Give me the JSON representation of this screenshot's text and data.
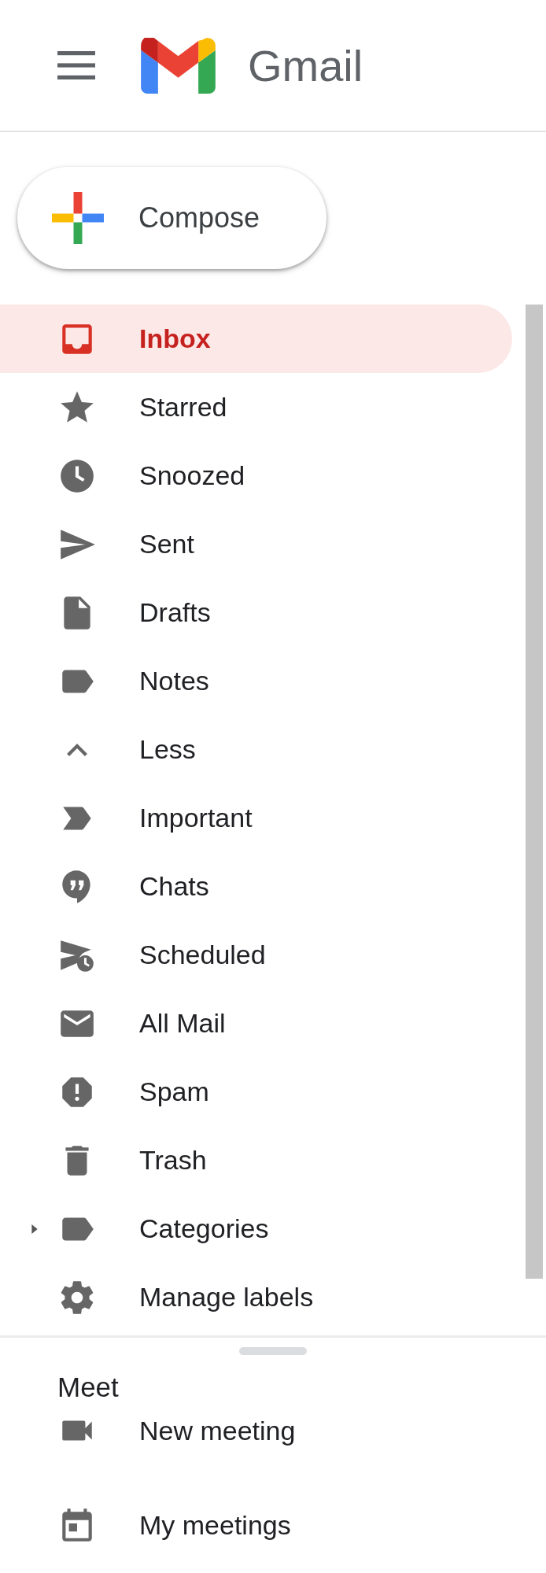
{
  "header": {
    "app_name": "Gmail"
  },
  "compose": {
    "label": "Compose"
  },
  "nav": [
    {
      "kind": "inbox",
      "label": "Inbox",
      "selected": true
    },
    {
      "kind": "star",
      "label": "Starred",
      "selected": false
    },
    {
      "kind": "clock",
      "label": "Snoozed",
      "selected": false
    },
    {
      "kind": "send",
      "label": "Sent",
      "selected": false
    },
    {
      "kind": "file",
      "label": "Drafts",
      "selected": false
    },
    {
      "kind": "label",
      "label": "Notes",
      "selected": false
    },
    {
      "kind": "less",
      "label": "Less",
      "selected": false
    },
    {
      "kind": "important",
      "label": "Important",
      "selected": false
    },
    {
      "kind": "chat",
      "label": "Chats",
      "selected": false
    },
    {
      "kind": "scheduled",
      "label": "Scheduled",
      "selected": false
    },
    {
      "kind": "mail",
      "label": "All Mail",
      "selected": false
    },
    {
      "kind": "spam",
      "label": "Spam",
      "selected": false
    },
    {
      "kind": "trash",
      "label": "Trash",
      "selected": false
    },
    {
      "kind": "category",
      "label": "Categories",
      "selected": false,
      "expanded": false
    },
    {
      "kind": "gear",
      "label": "Manage labels",
      "selected": false
    }
  ],
  "meet": {
    "title": "Meet",
    "items": [
      {
        "kind": "video",
        "label": "New meeting"
      },
      {
        "kind": "calendar",
        "label": "My meetings"
      }
    ]
  }
}
